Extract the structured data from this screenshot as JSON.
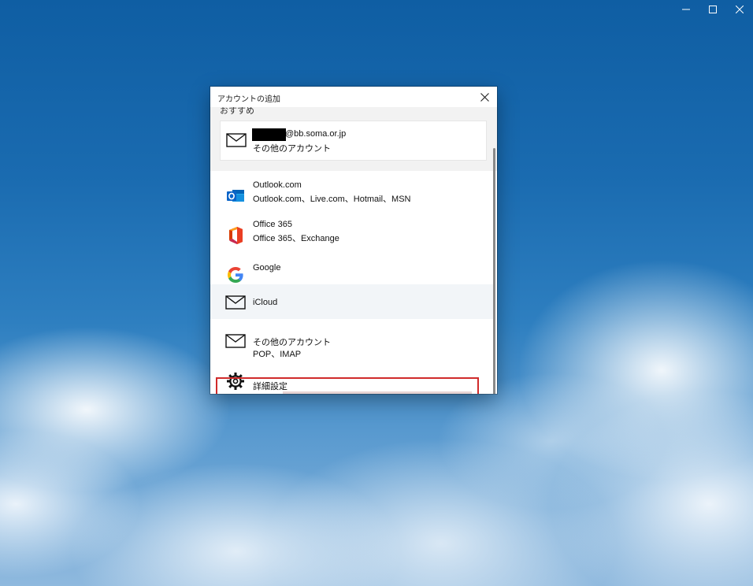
{
  "dialog": {
    "title": "アカウントの追加",
    "section_label": "おすすめ",
    "recommended": {
      "email_suffix": "@bb.soma.or.jp",
      "subtitle": "その他のアカウント",
      "icon": "mail-icon"
    },
    "items": [
      {
        "icon": "outlook-icon",
        "title": "Outlook.com",
        "subtitle": "Outlook.com、Live.com、Hotmail、MSN"
      },
      {
        "icon": "office-icon",
        "title": "Office 365",
        "subtitle": "Office 365、Exchange"
      },
      {
        "icon": "google-icon",
        "title": "Google",
        "subtitle": ""
      },
      {
        "icon": "mail-icon",
        "title": "iCloud",
        "subtitle": ""
      },
      {
        "icon": "mail-icon",
        "title": "その他のアカウント",
        "subtitle": "POP、IMAP"
      },
      {
        "icon": "gear-icon",
        "title": "詳細設定",
        "subtitle": ""
      }
    ]
  },
  "colors": {
    "highlight": "#d02b2b",
    "outlook_blue": "#0a64c8",
    "office_red": "#d83b01",
    "google_blue": "#4285f4"
  }
}
